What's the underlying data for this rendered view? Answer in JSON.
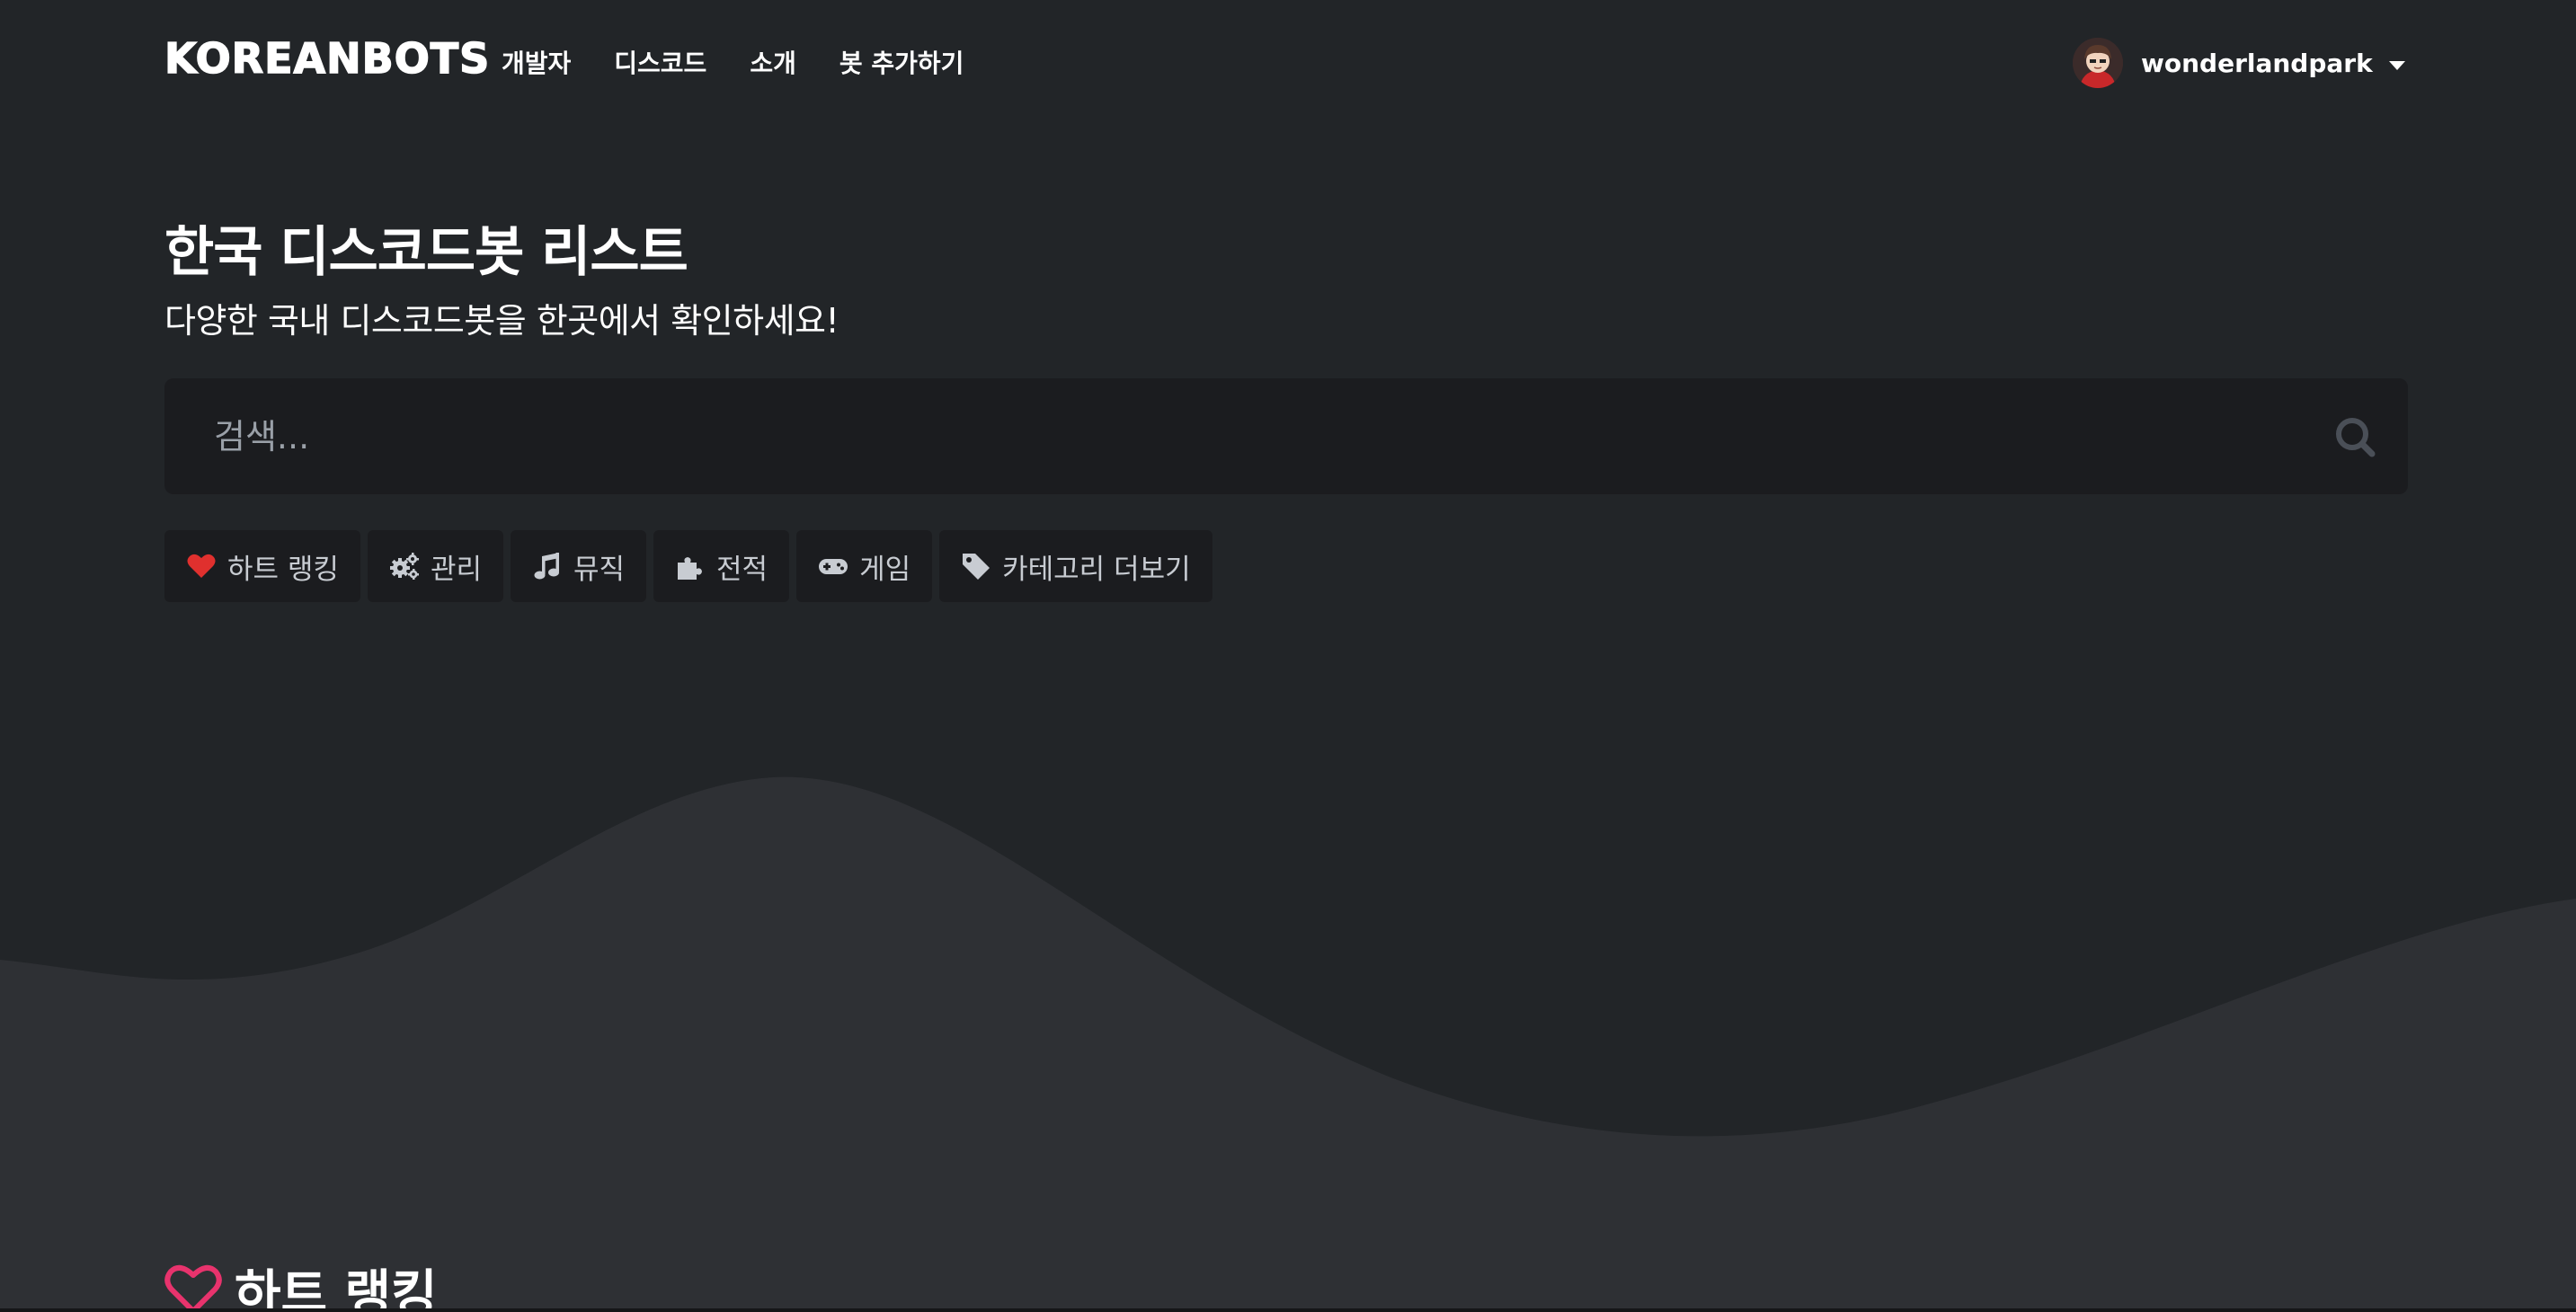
{
  "navbar": {
    "brand": "KOREANBOTS",
    "links": [
      "개발자",
      "디스코드",
      "소개",
      "봇 추가하기"
    ],
    "user": {
      "username": "wonderlandpark"
    }
  },
  "hero": {
    "title": "한국 디스코드봇 리스트",
    "subtitle": "다양한 국내 디스코드봇을 한곳에서 확인하세요!",
    "search": {
      "placeholder": "검색..."
    }
  },
  "categories": [
    {
      "label": "하트 랭킹",
      "icon": "heart-icon"
    },
    {
      "label": "관리",
      "icon": "cogs-icon"
    },
    {
      "label": "뮤직",
      "icon": "music-icon"
    },
    {
      "label": "전적",
      "icon": "puzzle-icon"
    },
    {
      "label": "게임",
      "icon": "gamepad-icon"
    },
    {
      "label": "카테고리 더보기",
      "icon": "tag-icon"
    }
  ],
  "section": {
    "title": "하트 랭킹",
    "icon": "heart-outline-icon"
  },
  "colors": {
    "background": "#222528",
    "wave": "#2e3034",
    "search_bg": "#1b1c1f",
    "heart_red": "#e0302e",
    "heart_pink": "#e8336d"
  }
}
